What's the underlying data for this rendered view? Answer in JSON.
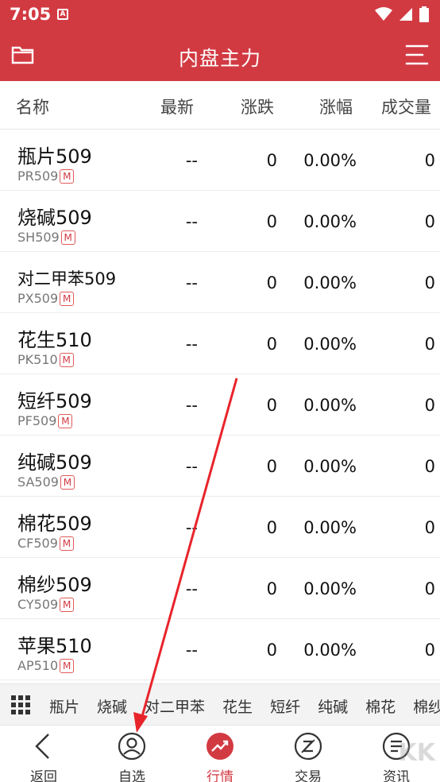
{
  "status": {
    "time": "7:05",
    "notif_letter": "A"
  },
  "appbar": {
    "title": "内盘主力"
  },
  "colors": {
    "brand": "#d23a42",
    "badge": "#e25a5a",
    "arrow": "#e8242b"
  },
  "header": {
    "name": "名称",
    "last": "最新",
    "change": "涨跌",
    "pct": "涨幅",
    "volume": "成交量"
  },
  "rows": [
    {
      "name": "瓶片509",
      "code": "PR509",
      "badge": "M",
      "last": "--",
      "change": "0",
      "pct": "0.00%",
      "volume": "0"
    },
    {
      "name": "烧碱509",
      "code": "SH509",
      "badge": "M",
      "last": "--",
      "change": "0",
      "pct": "0.00%",
      "volume": "0"
    },
    {
      "name": "对二甲苯509",
      "code": "PX509",
      "badge": "M",
      "last": "--",
      "change": "0",
      "pct": "0.00%",
      "volume": "0"
    },
    {
      "name": "花生510",
      "code": "PK510",
      "badge": "M",
      "last": "--",
      "change": "0",
      "pct": "0.00%",
      "volume": "0"
    },
    {
      "name": "短纤509",
      "code": "PF509",
      "badge": "M",
      "last": "--",
      "change": "0",
      "pct": "0.00%",
      "volume": "0"
    },
    {
      "name": "纯碱509",
      "code": "SA509",
      "badge": "M",
      "last": "--",
      "change": "0",
      "pct": "0.00%",
      "volume": "0"
    },
    {
      "name": "棉花509",
      "code": "CF509",
      "badge": "M",
      "last": "--",
      "change": "0",
      "pct": "0.00%",
      "volume": "0"
    },
    {
      "name": "棉纱509",
      "code": "CY509",
      "badge": "M",
      "last": "--",
      "change": "0",
      "pct": "0.00%",
      "volume": "0"
    },
    {
      "name": "苹果510",
      "code": "AP510",
      "badge": "M",
      "last": "--",
      "change": "0",
      "pct": "0.00%",
      "volume": "0"
    }
  ],
  "categories": [
    "瓶片",
    "烧碱",
    "对二甲苯",
    "花生",
    "短纤",
    "纯碱",
    "棉花",
    "棉纱"
  ],
  "tabs": [
    {
      "label": "返回",
      "icon": "back-icon"
    },
    {
      "label": "自选",
      "icon": "user-icon"
    },
    {
      "label": "行情",
      "icon": "trend-icon"
    },
    {
      "label": "交易",
      "icon": "trade-icon"
    },
    {
      "label": "资讯",
      "icon": "news-icon"
    }
  ],
  "watermark": "KK下载"
}
